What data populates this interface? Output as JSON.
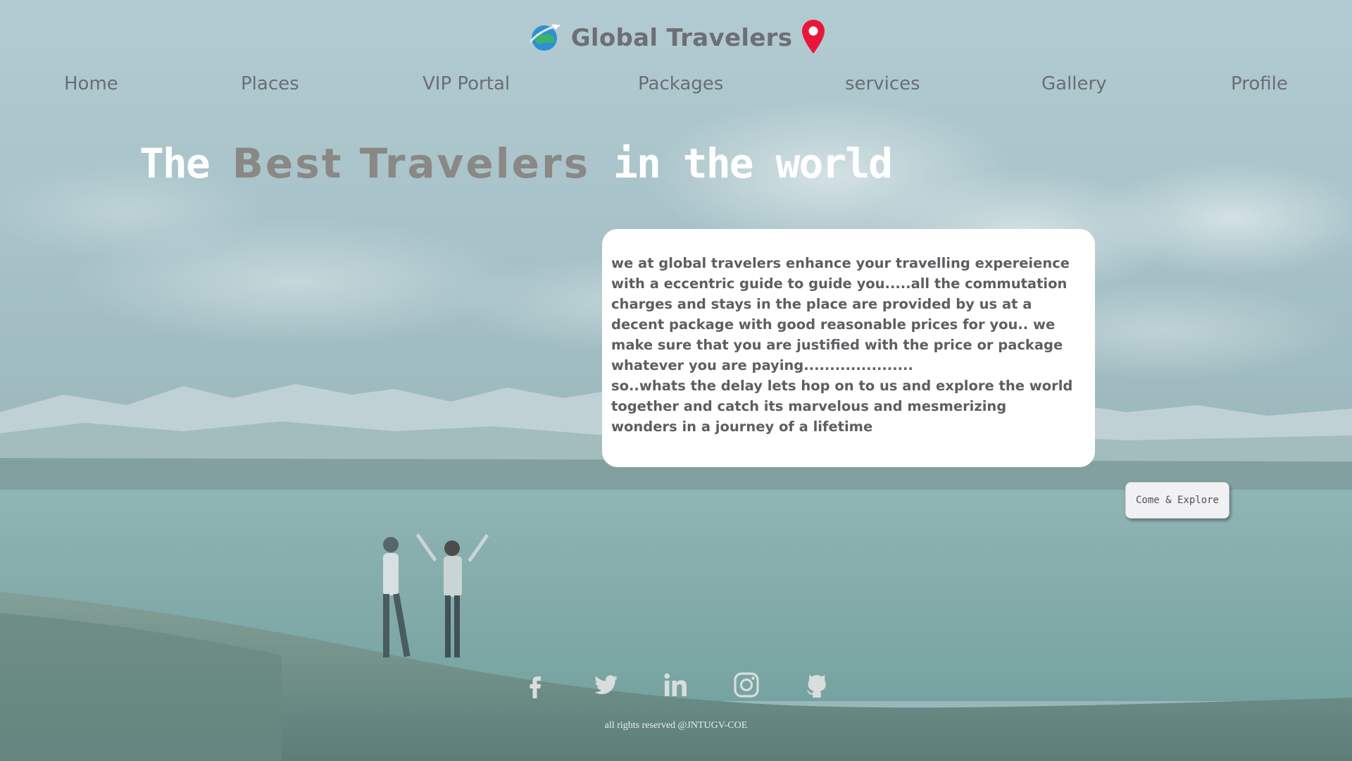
{
  "brand": {
    "title": "Global Travelers",
    "logo_icon": "globe-plane-icon",
    "pin_icon": "location-pin-icon",
    "pin_color": "#e8173a"
  },
  "nav": {
    "items": [
      {
        "label": "Home"
      },
      {
        "label": "Places"
      },
      {
        "label": "VIP Portal"
      },
      {
        "label": "Packages"
      },
      {
        "label": "services"
      },
      {
        "label": "Gallery"
      },
      {
        "label": "Profile"
      }
    ]
  },
  "hero": {
    "part1": "The ",
    "part2": "Best Travelers",
    "part3": " in the world"
  },
  "card": {
    "text": "we at global travelers enhance your travelling expereience with a eccentric guide to guide you.....all the commutation charges and stays in the place are provided by us at a decent package with good reasonable prices for you.. we make sure that you are justified with the price or package whatever you are paying.....................\nso..whats the delay lets hop on to us and explore the world together and catch its marvelous and mesmerizing wonders in a journey of a lifetime"
  },
  "cta": {
    "label": "Come & Explore"
  },
  "footer": {
    "socials": [
      {
        "icon": "facebook-icon"
      },
      {
        "icon": "twitter-icon"
      },
      {
        "icon": "linkedin-icon"
      },
      {
        "icon": "instagram-icon"
      },
      {
        "icon": "github-icon"
      }
    ],
    "copyright": "all rights reserved @JNTUGV-COE"
  }
}
